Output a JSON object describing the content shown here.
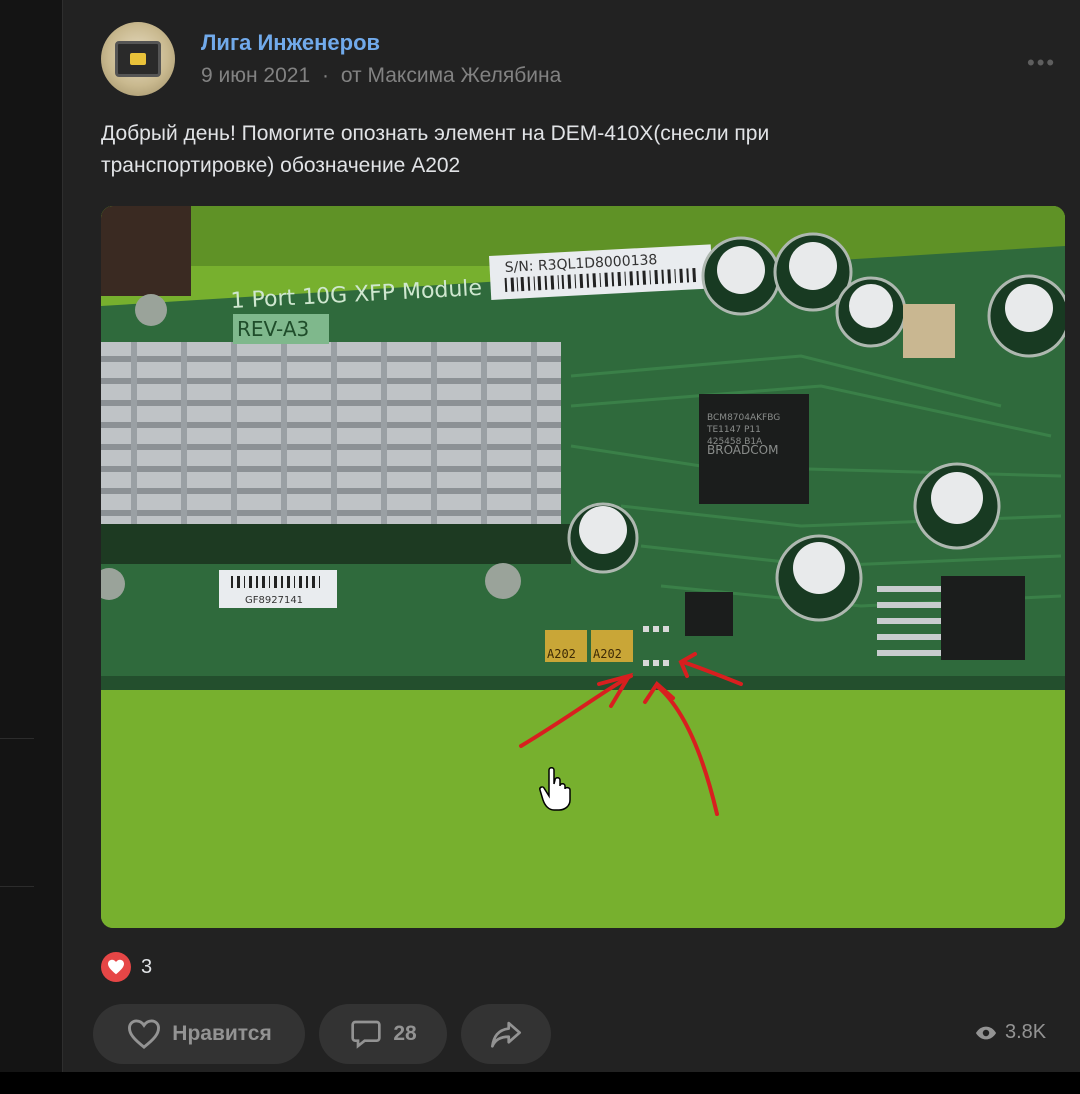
{
  "post": {
    "group_name": "Лига Инженеров",
    "date": "9 июн 2021",
    "separator": "·",
    "author": "от Максима Желябина",
    "text_line1": "Добрый день! Помогите опознать элемент на DEM-410X(снесли при",
    "text_line2": "транспортировке) обозначение А202",
    "more_icon": "more-dots-icon"
  },
  "photo": {
    "board_title": "1 Port 10G XFP Module",
    "rev": "REV-A3",
    "serial": "S/N: R3QL1D8000138",
    "barcode_label": "GF8927141",
    "chip_text": "BROADCOM",
    "chip_code1": "BCM8704AKFBG",
    "chip_code2": "TE1147 P11",
    "chip_code3": "425458 B1A",
    "component_label_1": "A202",
    "component_label_2": "A202",
    "colors": {
      "board": "#2f6a3c",
      "mat": "#76b02c",
      "arrows": "#d81f1f"
    }
  },
  "reactions": {
    "count": "3",
    "icon": "heart-icon",
    "color": "#e64646"
  },
  "actions": {
    "like_label": "Нравится",
    "comment_count": "28",
    "like_icon": "heart-outline-icon",
    "comment_icon": "comment-icon",
    "share_icon": "share-icon"
  },
  "views": {
    "count": "3.8K",
    "icon": "eye-icon"
  }
}
